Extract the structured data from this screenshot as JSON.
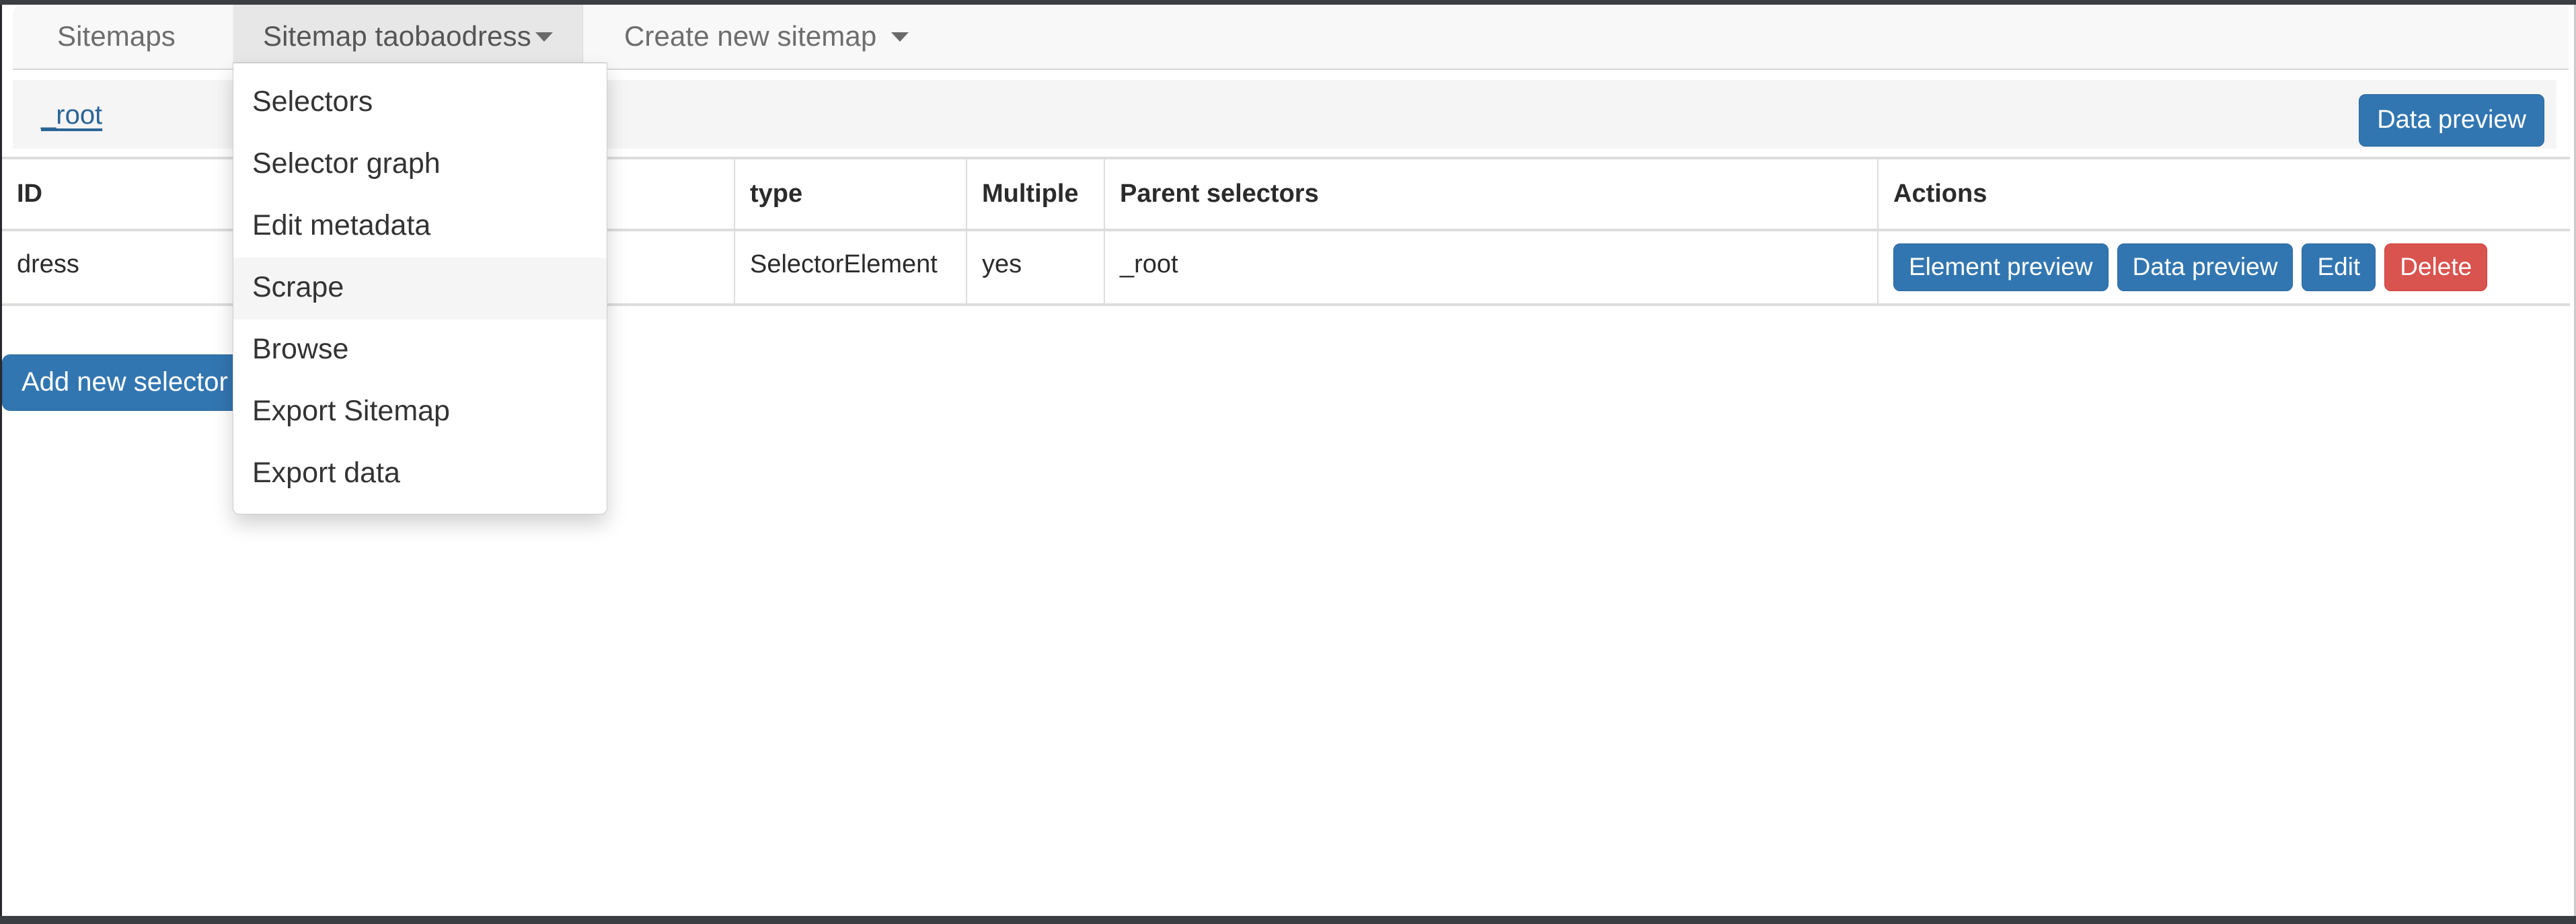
{
  "tabs": {
    "sitemaps_label": "Sitemaps",
    "active_sitemap_label": "Sitemap taobaodress",
    "create_sitemap_label": "Create new sitemap"
  },
  "breadcrumb": {
    "root_label": "_root",
    "data_preview_label": "Data preview"
  },
  "dropdown": {
    "items": [
      {
        "label": "Selectors",
        "highlighted": false
      },
      {
        "label": "Selector graph",
        "highlighted": false
      },
      {
        "label": "Edit metadata",
        "highlighted": false
      },
      {
        "label": "Scrape",
        "highlighted": true
      },
      {
        "label": "Browse",
        "highlighted": false
      },
      {
        "label": "Export Sitemap",
        "highlighted": false
      },
      {
        "label": "Export data",
        "highlighted": false
      }
    ]
  },
  "table": {
    "headers": {
      "id": "ID",
      "selector": "",
      "type": "type",
      "multiple": "Multiple",
      "parent_selectors": "Parent selectors",
      "actions": "Actions"
    },
    "rows": [
      {
        "id": "dress",
        "selector": "",
        "type": "SelectorElement",
        "multiple": "yes",
        "parent_selectors": "_root",
        "actions": {
          "element_preview": "Element preview",
          "data_preview": "Data preview",
          "edit": "Edit",
          "delete": "Delete"
        }
      }
    ]
  },
  "footer": {
    "add_new_selector_label": "Add new selector"
  },
  "colors": {
    "primary": "#3276b1",
    "danger": "#d9534f",
    "link": "#2a6496",
    "tab_active_bg": "#e7e7e7",
    "panel_bg": "#f5f5f5",
    "chrome_bar": "#3b3e42"
  }
}
